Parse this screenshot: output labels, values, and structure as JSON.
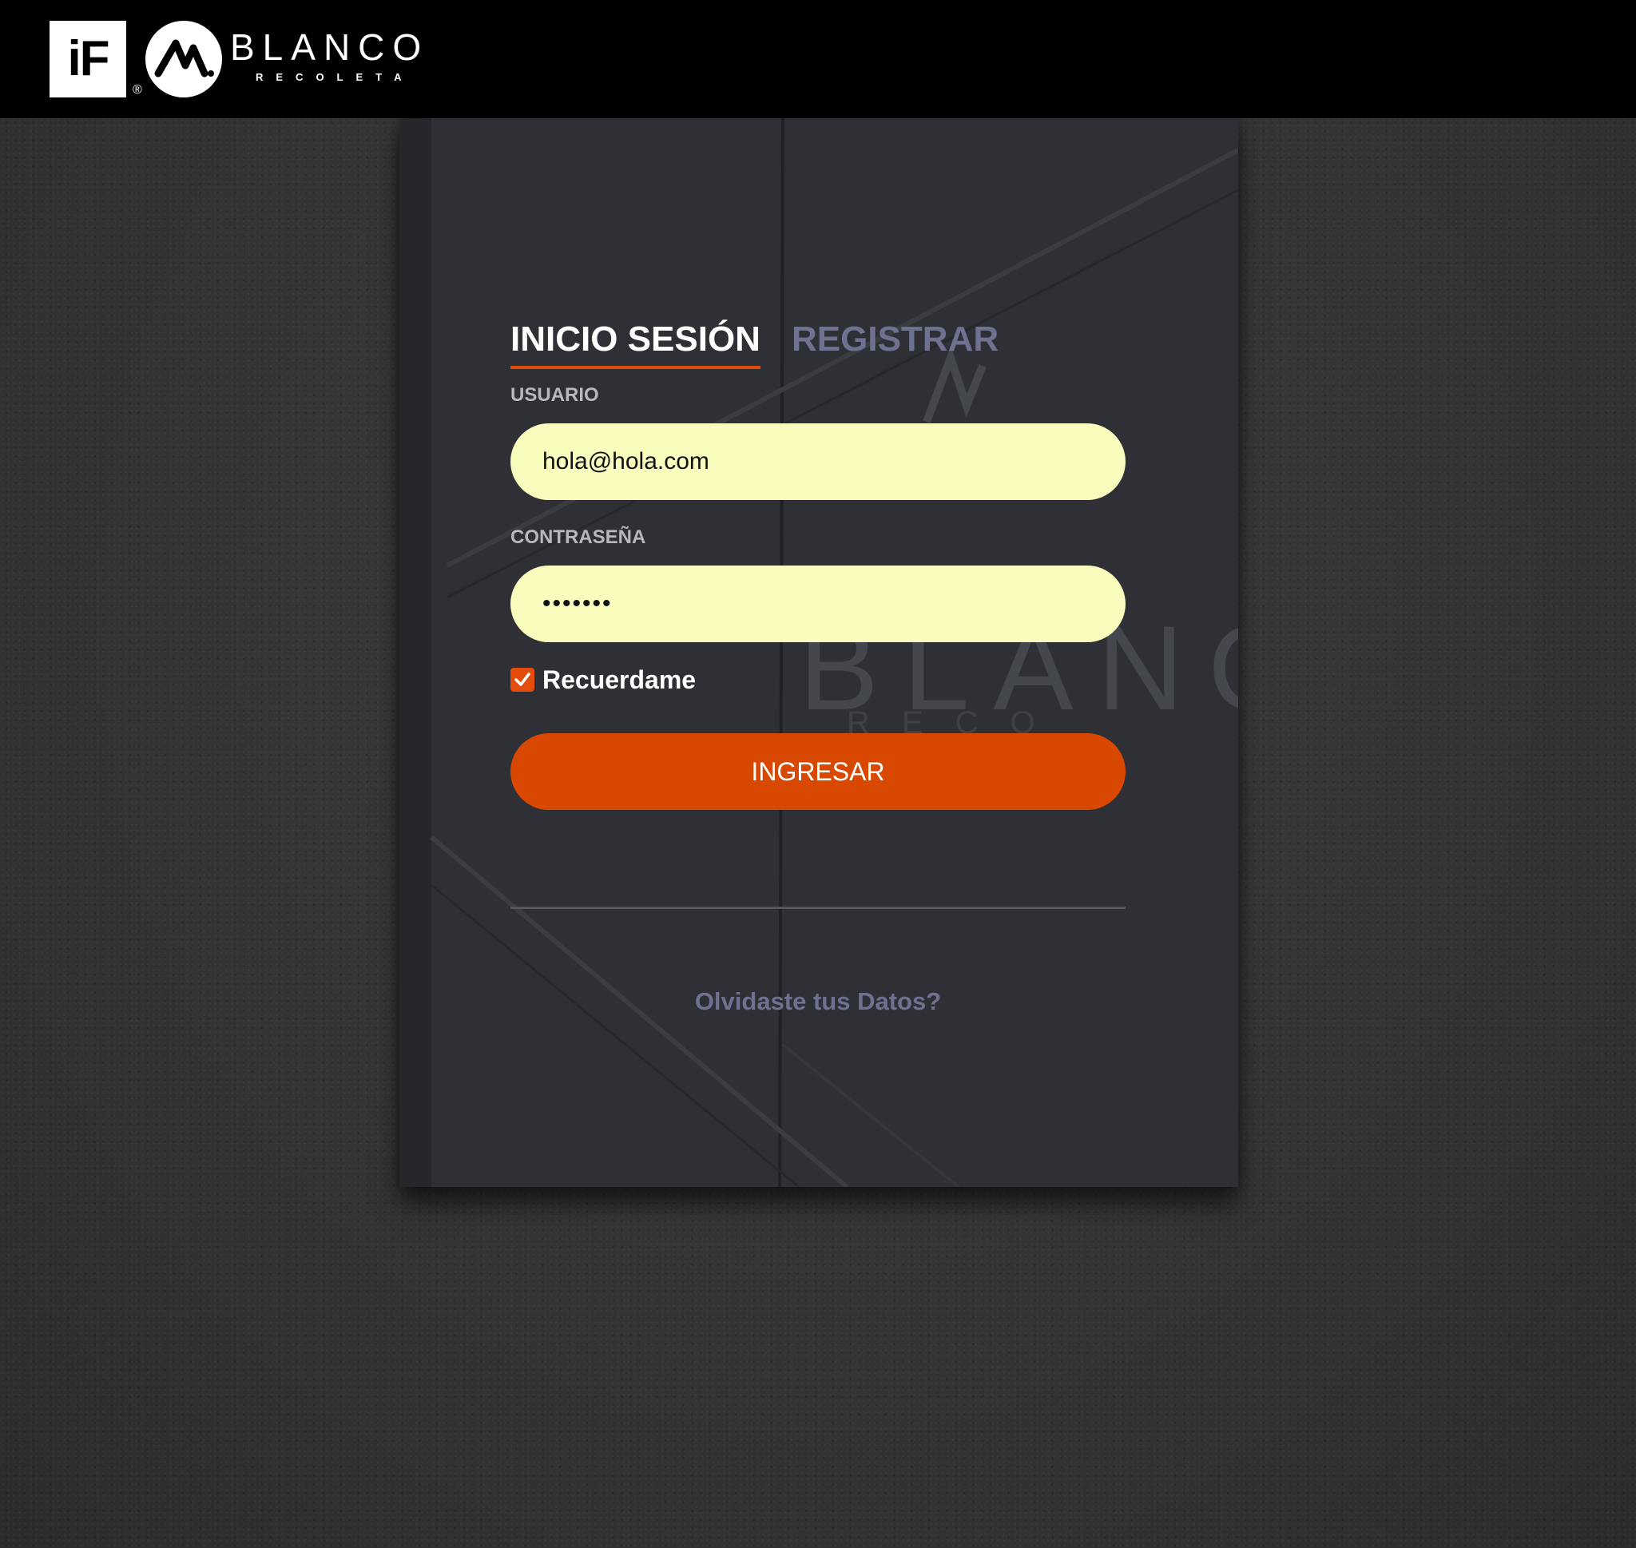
{
  "header": {
    "logo_if": "iF",
    "logo_registered": "®",
    "brand_name": "BLANCO",
    "brand_subtitle": "RECOLETA"
  },
  "login": {
    "tab_login": "INICIO SESIÓN",
    "tab_register": "REGISTRAR",
    "active_tab": "login",
    "username_label": "USUARIO",
    "username_value": "hola@hola.com",
    "password_label": "CONTRASEÑA",
    "password_value": "•••••••",
    "remember_label": "Recuerdame",
    "remember_checked": true,
    "submit_label": "INGRESAR",
    "forgot_label": "Olvidaste tus Datos?"
  },
  "colors": {
    "accent": "#d94800",
    "input_bg": "#f9fcbd",
    "muted_tab": "#6e7290",
    "topbar": "#000000"
  }
}
